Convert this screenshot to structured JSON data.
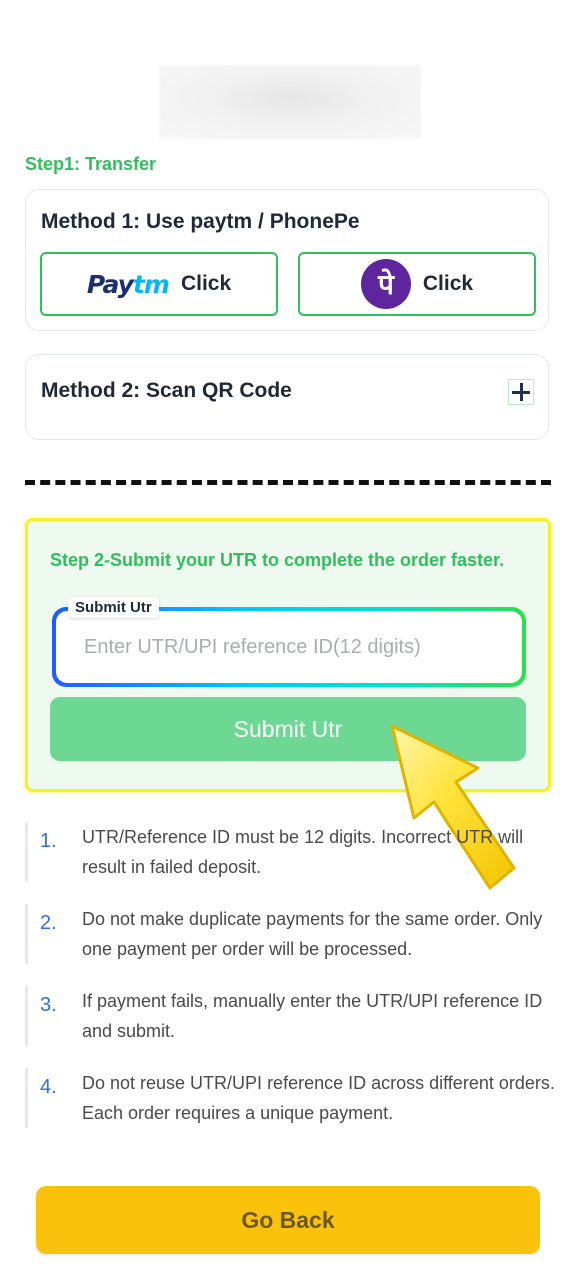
{
  "step1": {
    "title": "Step1: Transfer"
  },
  "method1": {
    "title": "Method 1: Use paytm / PhonePe",
    "paytm": {
      "logo_pay": "Pay",
      "logo_tm": "tm",
      "label": "Click",
      "icon": "paytm-logo-icon"
    },
    "phonepe": {
      "logo_glyph": "पे",
      "label": "Click",
      "icon": "phonepe-logo-icon"
    }
  },
  "method2": {
    "title": "Method 2: Scan QR Code",
    "icon": "plus-icon"
  },
  "step2": {
    "title": "Step 2-Submit your UTR to complete the order faster.",
    "input_label": "Submit Utr",
    "input_placeholder": "Enter UTR/UPI reference ID(12 digits)",
    "input_value": "",
    "submit_label": "Submit Utr"
  },
  "notes": [
    {
      "number": "1.",
      "text": "UTR/Reference ID must be 12 digits. Incorrect UTR will result in failed deposit."
    },
    {
      "number": "2.",
      "text": "Do not make duplicate payments for the same order. Only one payment per order will be processed."
    },
    {
      "number": "3.",
      "text": "If payment fails, manually enter the UTR/UPI reference ID and submit."
    },
    {
      "number": "4.",
      "text": "Do not reuse UTR/UPI reference ID across different orders. Each order requires a unique payment."
    }
  ],
  "footer": {
    "go_back_label": "Go Back"
  },
  "colors": {
    "accent_green": "#2fbf5c",
    "submit_green": "#6cd893",
    "go_back_yellow": "#fbc20b",
    "highlight_yellow": "#f7ef2a",
    "phonepe_purple": "#5f259f",
    "paytm_navy": "#1b2e6f",
    "paytm_cyan": "#00b9f1"
  }
}
